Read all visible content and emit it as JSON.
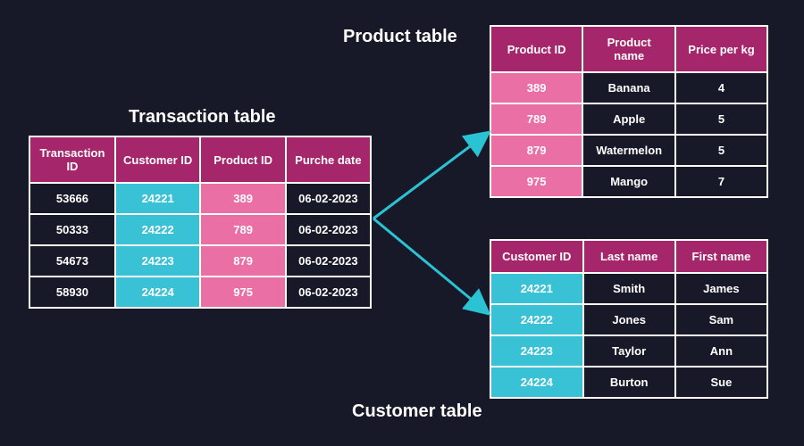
{
  "titles": {
    "transaction": "Transaction table",
    "product": "Product table",
    "customer": "Customer table"
  },
  "transaction": {
    "headers": [
      "Transaction ID",
      "Customer ID",
      "Product ID",
      "Purche date"
    ],
    "rows": [
      [
        "53666",
        "24221",
        "389",
        "06-02-2023"
      ],
      [
        "50333",
        "24222",
        "789",
        "06-02-2023"
      ],
      [
        "54673",
        "24223",
        "879",
        "06-02-2023"
      ],
      [
        "58930",
        "24224",
        "975",
        "06-02-2023"
      ]
    ]
  },
  "product": {
    "headers": [
      "Product ID",
      "Product name",
      "Price per kg"
    ],
    "rows": [
      [
        "389",
        "Banana",
        "4"
      ],
      [
        "789",
        "Apple",
        "5"
      ],
      [
        "879",
        "Watermelon",
        "5"
      ],
      [
        "975",
        "Mango",
        "7"
      ]
    ]
  },
  "customer": {
    "headers": [
      "Customer ID",
      "Last name",
      "First name"
    ],
    "rows": [
      [
        "24221",
        "Smith",
        "James"
      ],
      [
        "24222",
        "Jones",
        "Sam"
      ],
      [
        "24223",
        "Taylor",
        "Ann"
      ],
      [
        "24224",
        "Burton",
        "Sue"
      ]
    ]
  },
  "colors": {
    "header": "#a6266b",
    "pink": "#ea6fa5",
    "cyan": "#39c1d6",
    "bg": "#181928",
    "arrow": "#2ac3d4"
  }
}
